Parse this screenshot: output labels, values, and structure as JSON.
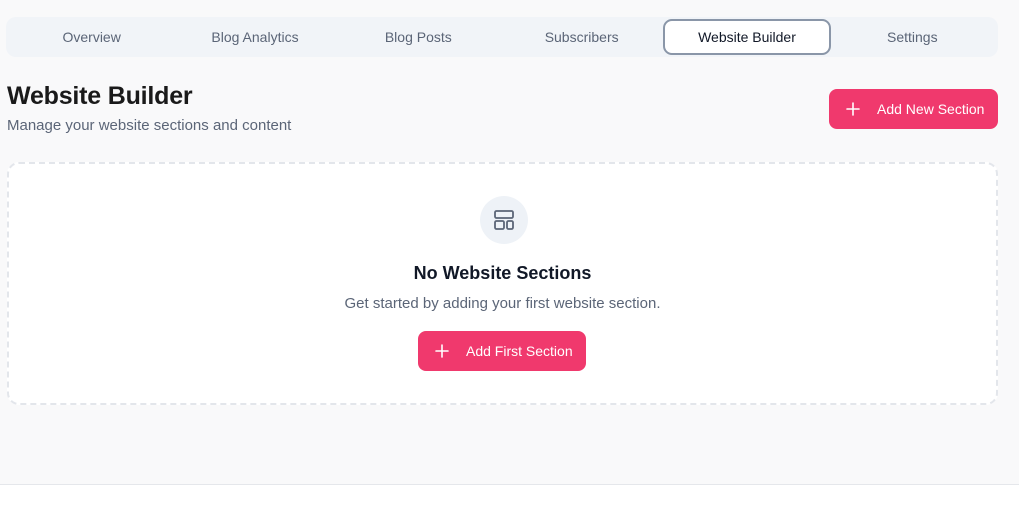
{
  "tabs": [
    {
      "label": "Overview",
      "active": false
    },
    {
      "label": "Blog Analytics",
      "active": false
    },
    {
      "label": "Blog Posts",
      "active": false
    },
    {
      "label": "Subscribers",
      "active": false
    },
    {
      "label": "Website Builder",
      "active": true
    },
    {
      "label": "Settings",
      "active": false
    }
  ],
  "header": {
    "title": "Website Builder",
    "subtitle": "Manage your website sections and content",
    "add_button_label": "Add New Section",
    "add_button_icon": "plus-icon"
  },
  "empty_state": {
    "icon": "layout-icon",
    "title": "No Website Sections",
    "description": "Get started by adding your first website section.",
    "button_label": "Add First Section",
    "button_icon": "plus-icon"
  },
  "colors": {
    "accent": "#f0396d",
    "active_tab_border": "#8a96a8",
    "muted_text": "#5b6577"
  }
}
